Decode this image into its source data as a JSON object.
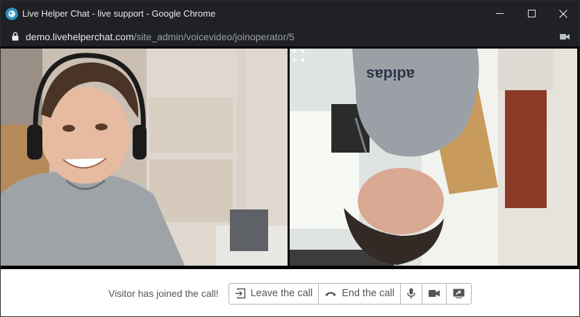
{
  "window": {
    "title": "Live Helper Chat - live support - Google Chrome",
    "url_host": "demo.livehelperchat.com",
    "url_path": "/site_admin/voicevideo/joinoperator/5"
  },
  "controls": {
    "status": "Visitor has joined the call!",
    "leave_label": "Leave the call",
    "end_label": "End the call"
  },
  "icons": {
    "app": "live-helper-chat-icon",
    "lock": "lock-icon",
    "camera_indicator": "camera-in-use-icon",
    "expand": "fullscreen-icon",
    "leave": "exit-icon",
    "end": "hang-up-phone-icon",
    "mic": "microphone-icon",
    "video": "video-camera-icon",
    "screen": "screen-share-icon"
  },
  "colors": {
    "titlebar": "#202124",
    "url_host": "#e8eaed",
    "url_path": "#9aa0a6",
    "button_border": "#adb5bd",
    "button_text": "#555555"
  }
}
